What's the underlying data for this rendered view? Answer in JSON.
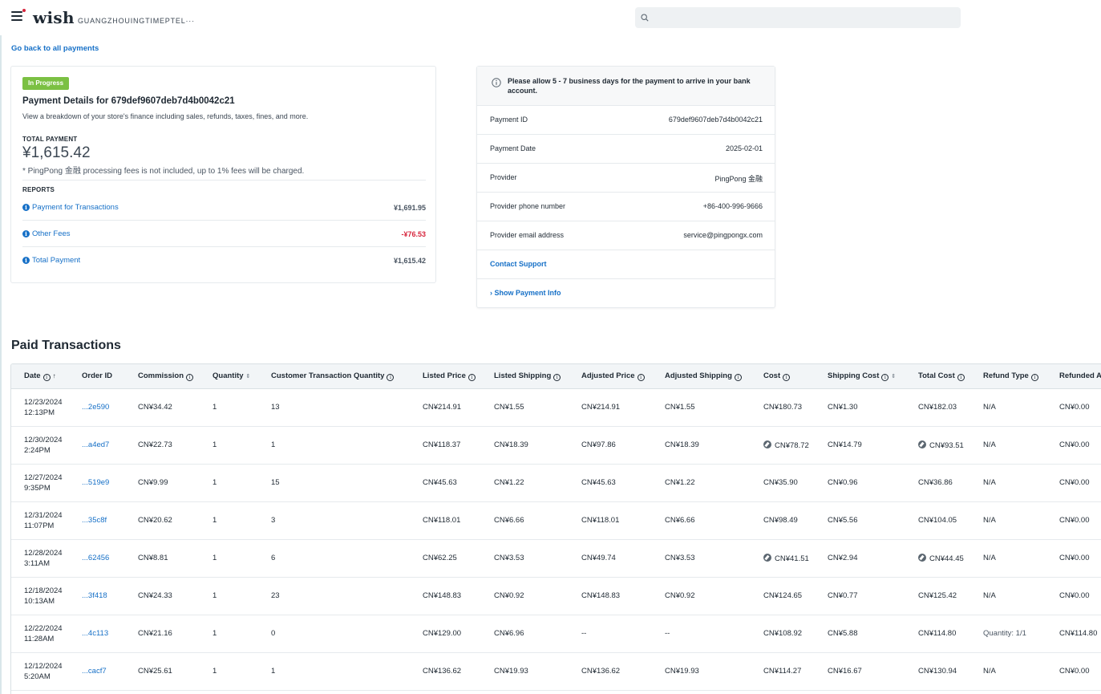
{
  "header": {
    "logo": "wish",
    "store_name": "GUANGZHOUINGTIMEPTEL···",
    "search_placeholder": ""
  },
  "back_link": "Go back to all payments",
  "summary": {
    "status": "In Progress",
    "title": "Payment Details for 679def9607deb7d4b0042c21",
    "subtitle": "View a breakdown of your store's finance including sales, refunds, taxes, fines, and more.",
    "total_label": "TOTAL PAYMENT",
    "total_amount": "¥1,615.42",
    "fee_note": "* PingPong 金融 processing fees is not included, up to 1% fees will be charged.",
    "reports_label": "REPORTS",
    "reports": [
      {
        "label": "Payment for Transactions",
        "value": "¥1,691.95"
      },
      {
        "label": "Other Fees",
        "value": "-¥76.53"
      },
      {
        "label": "Total Payment",
        "value": "¥1,615.42"
      }
    ]
  },
  "info": {
    "notice": "Please allow 5 - 7 business days for the payment to arrive in your bank account.",
    "rows": [
      {
        "key": "Payment ID",
        "value": "679def9607deb7d4b0042c21"
      },
      {
        "key": "Payment Date",
        "value": "2025-02-01"
      },
      {
        "key": "Provider",
        "value": "PingPong 金融"
      },
      {
        "key": "Provider phone number",
        "value": "+86-400-996-9666"
      },
      {
        "key": "Provider email address",
        "value": "service@pingpongx.com"
      }
    ],
    "contact_support": "Contact Support",
    "show_payment_info": "Show Payment Info"
  },
  "transactions": {
    "title": "Paid Transactions",
    "columns": [
      "Date",
      "Order ID",
      "Commission",
      "Quantity",
      "Customer Transaction Quantity",
      "Listed Price",
      "Listed Shipping",
      "Adjusted Price",
      "Adjusted Shipping",
      "Cost",
      "Shipping Cost",
      "Total Cost",
      "Refund Type",
      "Refunded Amount"
    ],
    "rows": [
      {
        "date1": "12/23/2024",
        "date2": "12:13PM",
        "order": "...2e590",
        "commission": "CN¥34.42",
        "quantity": "1",
        "ctq": "13",
        "listed_price": "CN¥214.91",
        "listed_shipping": "CN¥1.55",
        "adjusted_price": "CN¥214.91",
        "adjusted_shipping": "CN¥1.55",
        "cost": "CN¥180.73",
        "shipping_cost": "CN¥1.30",
        "total_cost": "CN¥182.03",
        "refund_type": "N/A",
        "refunded": "CN¥0.00"
      },
      {
        "date1": "12/30/2024",
        "date2": "2:24PM",
        "order": "...a4ed7",
        "commission": "CN¥22.73",
        "quantity": "1",
        "ctq": "1",
        "listed_price": "CN¥118.37",
        "listed_shipping": "CN¥18.39",
        "adjusted_price": "CN¥97.86",
        "adjusted_shipping": "CN¥18.39",
        "cost": "CN¥78.72",
        "shipping_cost": "CN¥14.79",
        "total_cost": "CN¥93.51",
        "refund_type": "N/A",
        "refunded": "CN¥0.00",
        "cost_edited": true
      },
      {
        "date1": "12/27/2024",
        "date2": "9:35PM",
        "order": "...519e9",
        "commission": "CN¥9.99",
        "quantity": "1",
        "ctq": "15",
        "listed_price": "CN¥45.63",
        "listed_shipping": "CN¥1.22",
        "adjusted_price": "CN¥45.63",
        "adjusted_shipping": "CN¥1.22",
        "cost": "CN¥35.90",
        "shipping_cost": "CN¥0.96",
        "total_cost": "CN¥36.86",
        "refund_type": "N/A",
        "refunded": "CN¥0.00"
      },
      {
        "date1": "12/31/2024",
        "date2": "11:07PM",
        "order": "...35c8f",
        "commission": "CN¥20.62",
        "quantity": "1",
        "ctq": "3",
        "listed_price": "CN¥118.01",
        "listed_shipping": "CN¥6.66",
        "adjusted_price": "CN¥118.01",
        "adjusted_shipping": "CN¥6.66",
        "cost": "CN¥98.49",
        "shipping_cost": "CN¥5.56",
        "total_cost": "CN¥104.05",
        "refund_type": "N/A",
        "refunded": "CN¥0.00"
      },
      {
        "date1": "12/28/2024",
        "date2": "3:11AM",
        "order": "...62456",
        "commission": "CN¥8.81",
        "quantity": "1",
        "ctq": "6",
        "listed_price": "CN¥62.25",
        "listed_shipping": "CN¥3.53",
        "adjusted_price": "CN¥49.74",
        "adjusted_shipping": "CN¥3.53",
        "cost": "CN¥41.51",
        "shipping_cost": "CN¥2.94",
        "total_cost": "CN¥44.45",
        "refund_type": "N/A",
        "refunded": "CN¥0.00",
        "cost_edited": true
      },
      {
        "date1": "12/18/2024",
        "date2": "10:13AM",
        "order": "...3f418",
        "commission": "CN¥24.33",
        "quantity": "1",
        "ctq": "23",
        "listed_price": "CN¥148.83",
        "listed_shipping": "CN¥0.92",
        "adjusted_price": "CN¥148.83",
        "adjusted_shipping": "CN¥0.92",
        "cost": "CN¥124.65",
        "shipping_cost": "CN¥0.77",
        "total_cost": "CN¥125.42",
        "refund_type": "N/A",
        "refunded": "CN¥0.00"
      },
      {
        "date1": "12/22/2024",
        "date2": "11:28AM",
        "order": "...4c113",
        "commission": "CN¥21.16",
        "quantity": "1",
        "ctq": "0",
        "listed_price": "CN¥129.00",
        "listed_shipping": "CN¥6.96",
        "adjusted_price": "--",
        "adjusted_shipping": "--",
        "cost": "CN¥108.92",
        "shipping_cost": "CN¥5.88",
        "total_cost": "CN¥114.80",
        "refund_type": "Quantity: 1/1",
        "refunded": "CN¥114.80"
      },
      {
        "date1": "12/12/2024",
        "date2": "5:20AM",
        "order": "...cacf7",
        "commission": "CN¥25.61",
        "quantity": "1",
        "ctq": "1",
        "listed_price": "CN¥136.62",
        "listed_shipping": "CN¥19.93",
        "adjusted_price": "CN¥136.62",
        "adjusted_shipping": "CN¥19.93",
        "cost": "CN¥114.27",
        "shipping_cost": "CN¥16.67",
        "total_cost": "CN¥130.94",
        "refund_type": "N/A",
        "refunded": "CN¥0.00"
      }
    ]
  }
}
